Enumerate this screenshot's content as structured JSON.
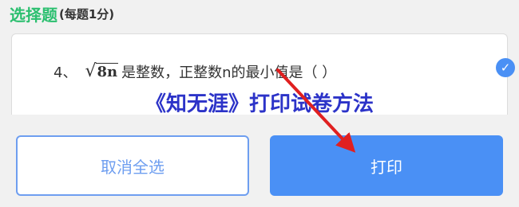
{
  "section": {
    "title": "选择题",
    "subtitle": "(每题1分)"
  },
  "question": {
    "number": "4、",
    "radicand": "8n",
    "text": "是整数，正整数n的最小值是（ ）",
    "selected": true
  },
  "overlay": {
    "caption": "《知无涯》打印试卷方法"
  },
  "actions": {
    "cancel_label": "取消全选",
    "print_label": "打印"
  },
  "colors": {
    "accent_green": "#2bbf6f",
    "accent_blue": "#4a90f5",
    "caption_blue": "#2c33c8",
    "arrow_red": "#e02020"
  },
  "icons": {
    "check": "check-icon",
    "annotation_arrow": "arrow-icon"
  }
}
